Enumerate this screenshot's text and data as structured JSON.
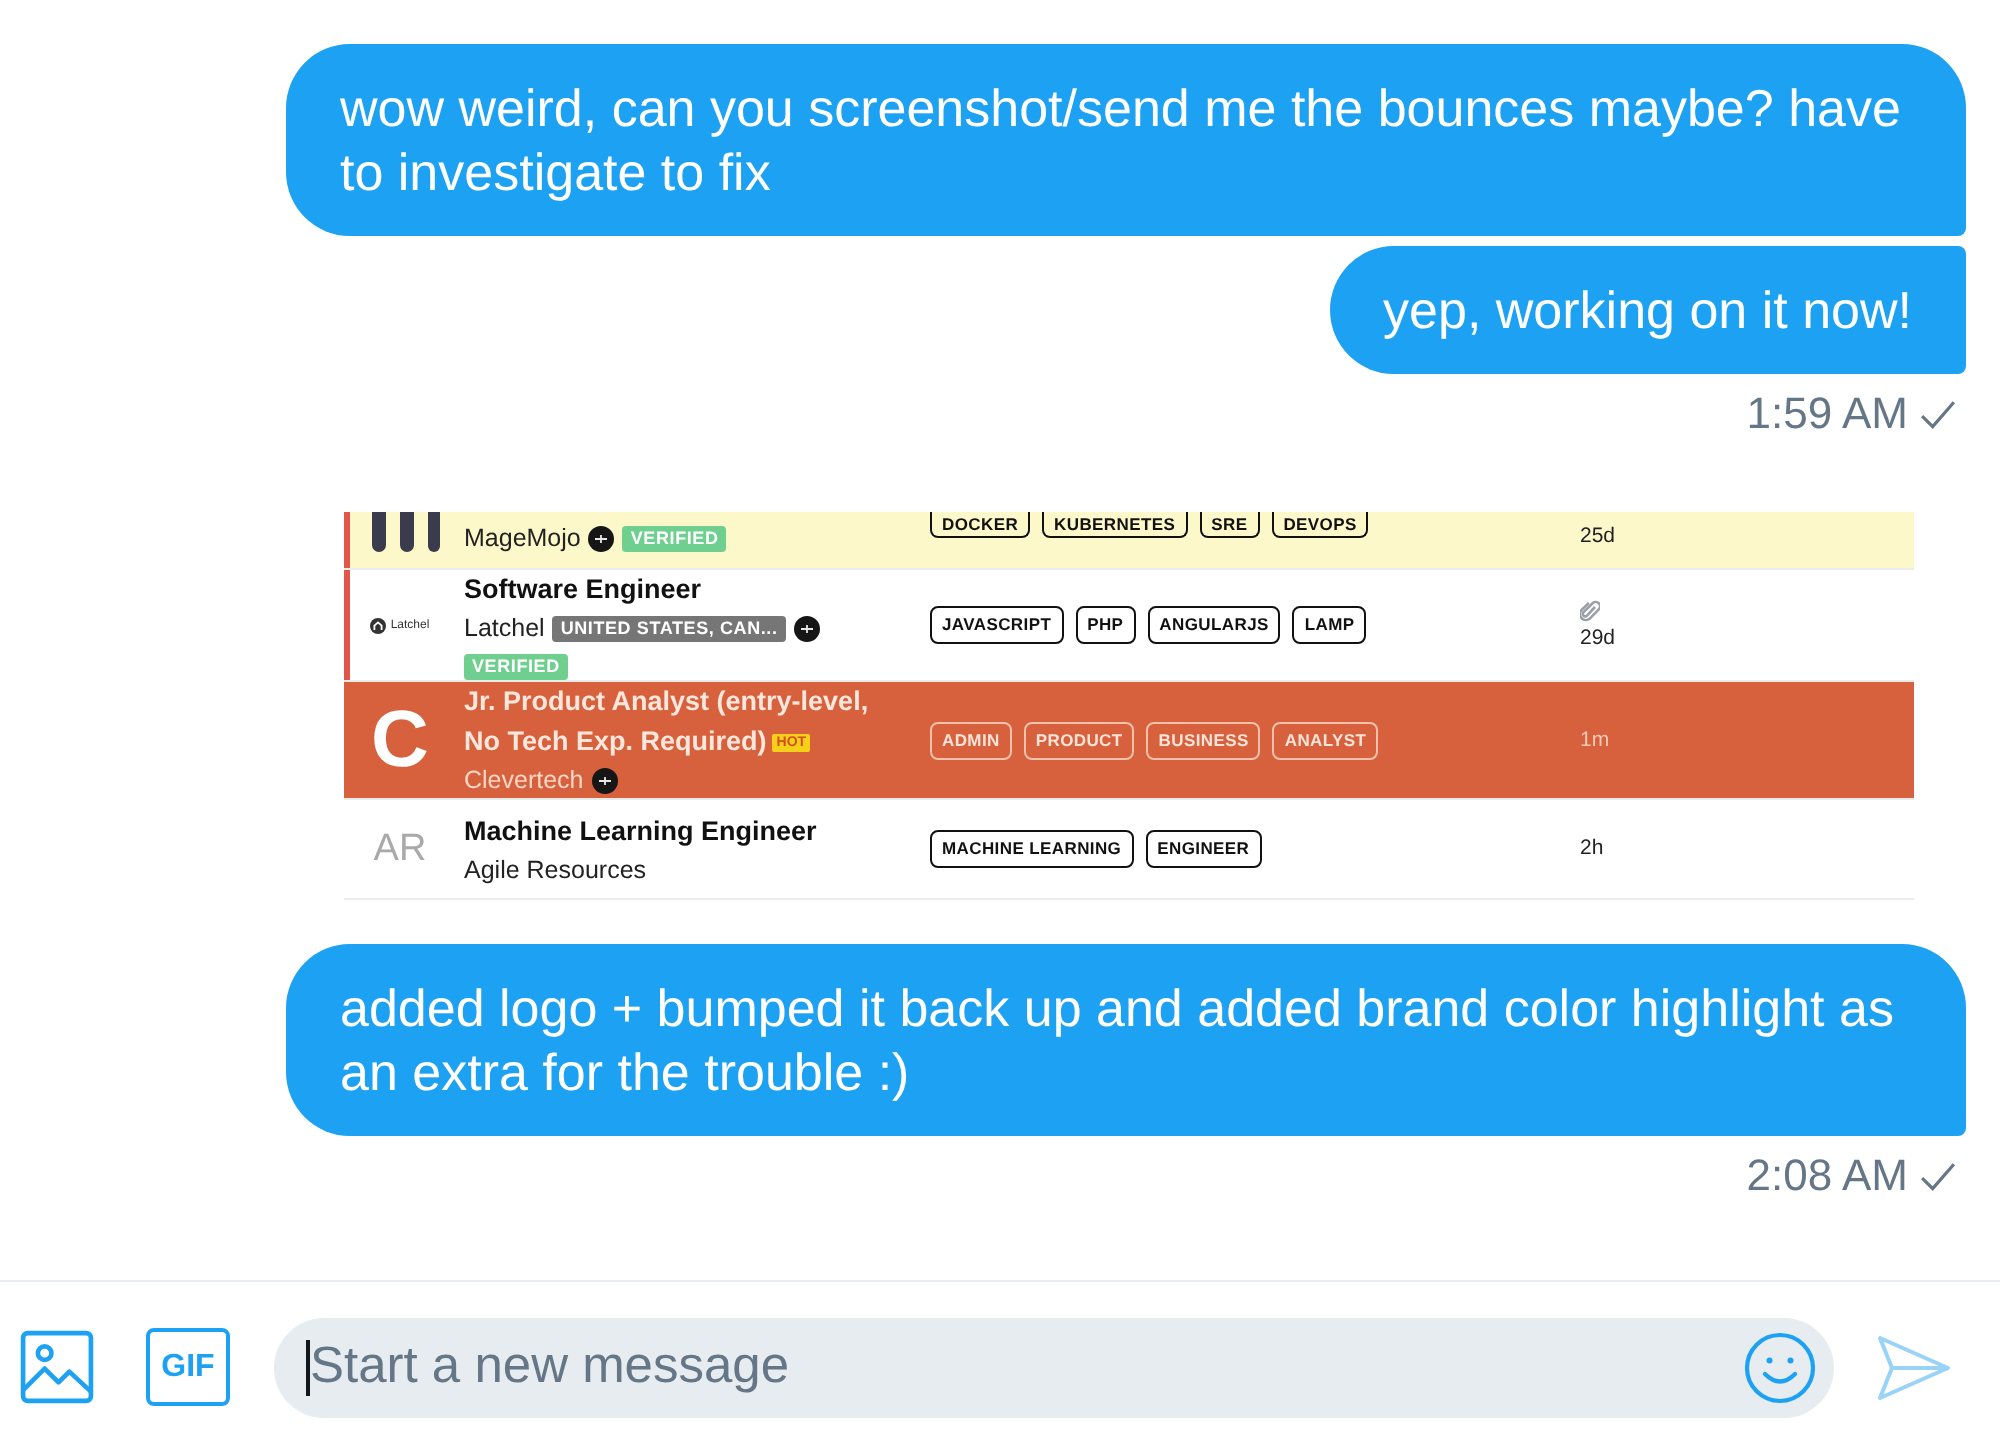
{
  "conversation": [
    {
      "kind": "bubble",
      "text": "wow weird, can you screenshot/send me the bounces maybe? have to investigate to fix"
    },
    {
      "kind": "bubble",
      "text": "yep, working on it now!"
    },
    {
      "kind": "timestamp",
      "time": "1:59 AM"
    },
    {
      "kind": "image",
      "rows": [
        {
          "kind": "standard",
          "color": "#fdf8c9",
          "left_stripe": true,
          "clipped": true,
          "logo": {
            "kind": "bars"
          },
          "company": "MageMojo",
          "company_badges": [
            {
              "kind": "seal"
            },
            {
              "kind": "verified",
              "text": "VERIFIED"
            }
          ],
          "tags": [
            "DOCKER",
            "KUBERNETES",
            "SRE",
            "DEVOPS"
          ],
          "attachment": false,
          "age": "25d"
        },
        {
          "kind": "standard",
          "color": "#ffffff",
          "left_stripe": true,
          "clipped": false,
          "logo": {
            "kind": "mark_and_text",
            "text": "Latchel"
          },
          "title": "Software Engineer",
          "company": "Latchel",
          "company_badges": [
            {
              "kind": "location",
              "text": "UNITED STATES, CAN..."
            },
            {
              "kind": "seal"
            },
            {
              "kind": "verified",
              "text": "VERIFIED"
            }
          ],
          "tags": [
            "JAVASCRIPT",
            "PHP",
            "ANGULARJS",
            "LAMP"
          ],
          "attachment": true,
          "age": "29d"
        },
        {
          "kind": "brand",
          "color": "#d6613c",
          "left_stripe": false,
          "clipped": false,
          "logo": {
            "kind": "letter",
            "text": "C"
          },
          "title": "Jr. Product Analyst (entry-level, No Tech Exp. Required)",
          "title_badge": "HOT",
          "company": "Clevertech",
          "company_badges": [
            {
              "kind": "seal"
            }
          ],
          "tags": [
            "ADMIN",
            "PRODUCT",
            "BUSINESS",
            "ANALYST"
          ],
          "attachment": false,
          "age": "1m"
        },
        {
          "kind": "standard",
          "color": "#ffffff",
          "left_stripe": false,
          "clipped": false,
          "logo": {
            "kind": "initials",
            "text": "AR"
          },
          "title": "Machine Learning Engineer",
          "company": "Agile Resources",
          "company_badges": [],
          "tags": [
            "MACHINE LEARNING",
            "ENGINEER"
          ],
          "attachment": false,
          "age": "2h"
        }
      ]
    },
    {
      "kind": "bubble",
      "text": "added logo + bumped it back up and added brand color highlight as an extra for the trouble :)"
    },
    {
      "kind": "timestamp",
      "time": "2:08 AM"
    }
  ],
  "composer": {
    "gif_label": "GIF",
    "placeholder": "Start a new message",
    "send_enabled": false
  }
}
